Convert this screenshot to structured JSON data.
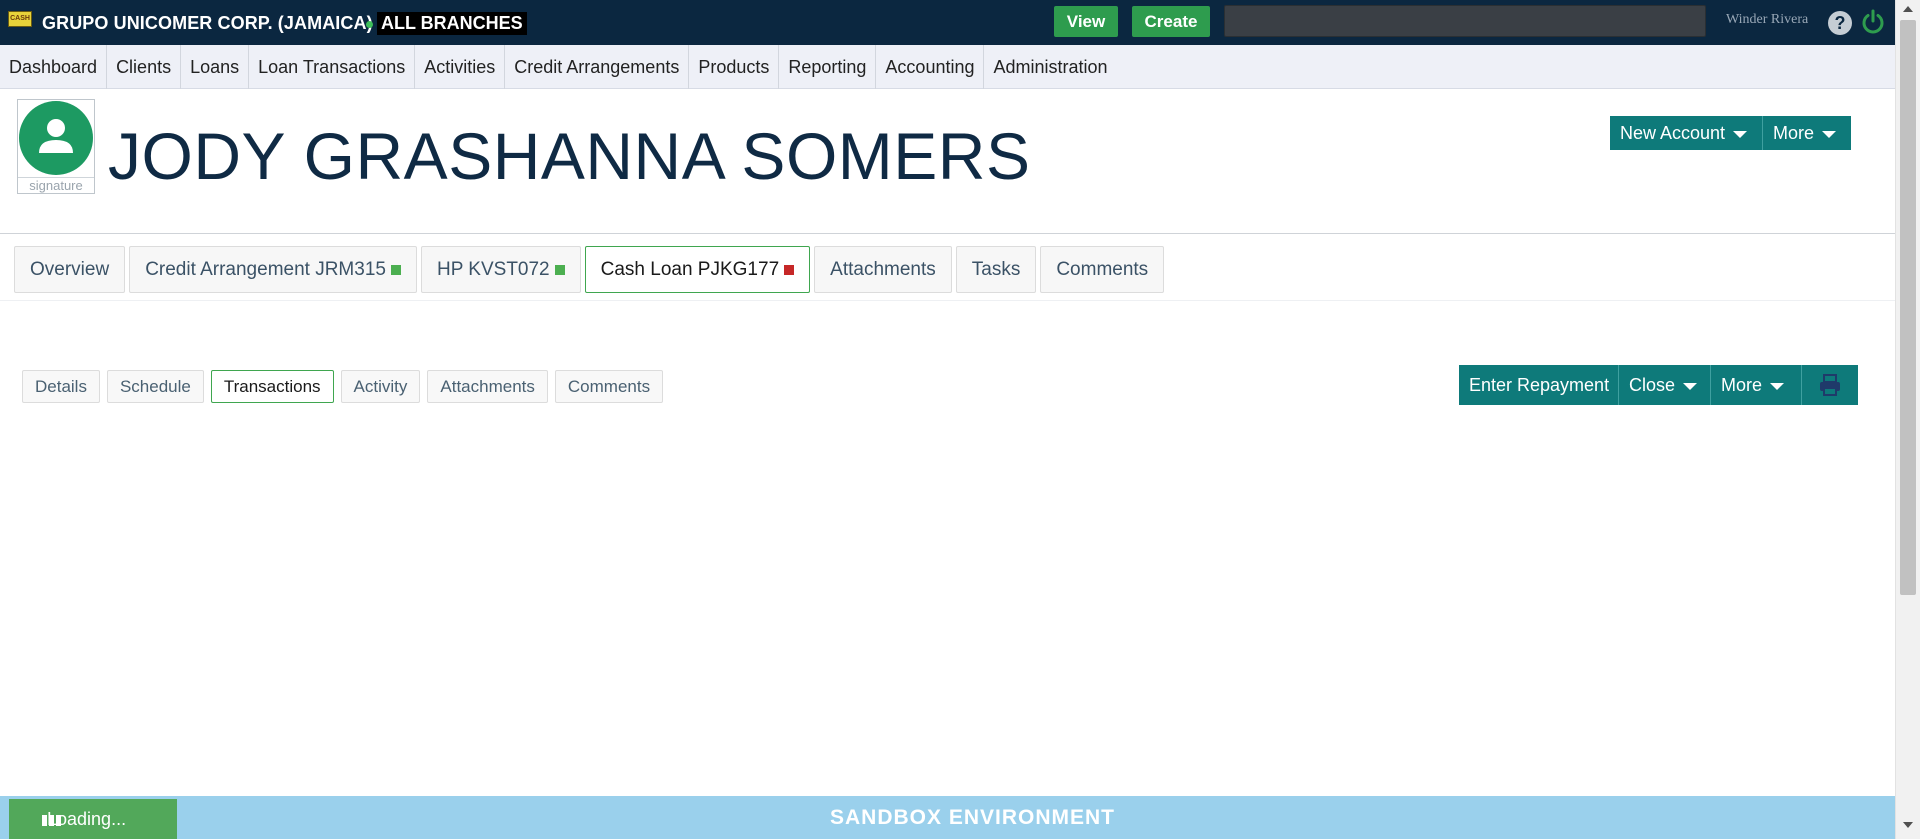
{
  "colors": {
    "topbar_bg": "#0b2740",
    "menubar_bg": "#eef0f7",
    "accent_green": "#2e9c4e",
    "teal": "#0e7a7a",
    "active_tab_border": "#3fa64f",
    "status_active": "#4caf50",
    "status_alert": "#c62828",
    "sandbox_bg": "#9ad0ec",
    "avatar_bg": "#1d9a62"
  },
  "topbar": {
    "logo_text": "CASH",
    "company": "GRUPO UNICOMER CORP. (JAMAICA)",
    "branch": "ALL BRANCHES",
    "view_label": "View",
    "create_label": "Create",
    "search_value": "",
    "user_name": "Winder Rivera",
    "help_icon": "question-circle-icon",
    "power_icon": "power-icon"
  },
  "menu": [
    {
      "label": "Dashboard"
    },
    {
      "label": "Clients"
    },
    {
      "label": "Loans"
    },
    {
      "label": "Loan Transactions"
    },
    {
      "label": "Activities"
    },
    {
      "label": "Credit Arrangements"
    },
    {
      "label": "Products"
    },
    {
      "label": "Reporting"
    },
    {
      "label": "Accounting"
    },
    {
      "label": "Administration"
    }
  ],
  "client": {
    "name": "JODY GRASHANNA SOMERS",
    "avatar_caption": "signature",
    "actions": [
      {
        "label": "New Account",
        "dropdown": true
      },
      {
        "label": "More",
        "dropdown": true
      }
    ]
  },
  "tabs": [
    {
      "label": "Overview",
      "status": "",
      "active": false
    },
    {
      "label": "Credit Arrangement JRM315",
      "status": "green",
      "active": false
    },
    {
      "label": "HP KVST072",
      "status": "green",
      "active": false
    },
    {
      "label": "Cash Loan PJKG177",
      "status": "red",
      "active": true
    },
    {
      "label": "Attachments",
      "status": "",
      "active": false
    },
    {
      "label": "Tasks",
      "status": "",
      "active": false
    },
    {
      "label": "Comments",
      "status": "",
      "active": false
    }
  ],
  "subtabs": [
    {
      "label": "Details",
      "active": false
    },
    {
      "label": "Schedule",
      "active": false
    },
    {
      "label": "Transactions",
      "active": true
    },
    {
      "label": "Activity",
      "active": false
    },
    {
      "label": "Attachments",
      "active": false
    },
    {
      "label": "Comments",
      "active": false
    }
  ],
  "loan_actions": {
    "enter_repayment": "Enter Repayment",
    "close": "Close",
    "more": "More",
    "print_icon": "printer-icon"
  },
  "footer": {
    "sandbox": "SANDBOX ENVIRONMENT",
    "loading": "Loading..."
  }
}
